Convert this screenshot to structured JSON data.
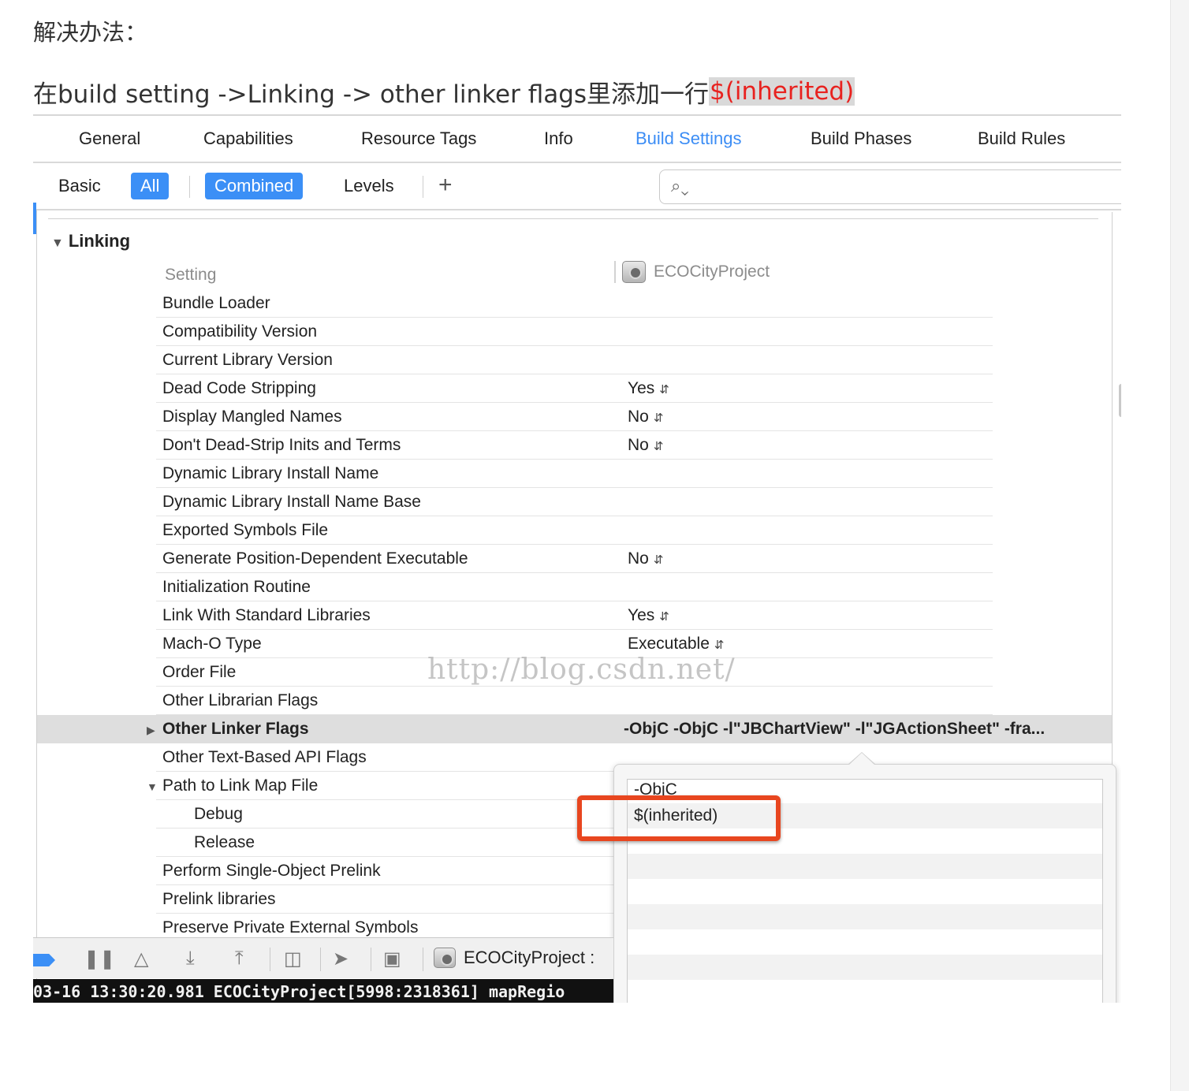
{
  "article": {
    "heading": "解决办法：",
    "instruction_prefix": "在build setting ->Linking -> other linker flags里添加一行",
    "instruction_highlight": "$(inherited)"
  },
  "tabs": [
    "General",
    "Capabilities",
    "Resource Tags",
    "Info",
    "Build Settings",
    "Build Phases",
    "Build Rules"
  ],
  "active_tab": "Build Settings",
  "filter": {
    "basic": "Basic",
    "all": "All",
    "combined": "Combined",
    "levels": "Levels",
    "add": "+",
    "search_placeholder": ""
  },
  "section": {
    "title": "Linking",
    "column_setting": "Setting",
    "column_target": "ECOCityProject"
  },
  "rows": [
    {
      "name": "Bundle Loader",
      "value": ""
    },
    {
      "name": "Compatibility Version",
      "value": ""
    },
    {
      "name": "Current Library Version",
      "value": ""
    },
    {
      "name": "Dead Code Stripping",
      "value": "Yes"
    },
    {
      "name": "Display Mangled Names",
      "value": "No"
    },
    {
      "name": "Don't Dead-Strip Inits and Terms",
      "value": "No"
    },
    {
      "name": "Dynamic Library Install Name",
      "value": ""
    },
    {
      "name": "Dynamic Library Install Name Base",
      "value": ""
    },
    {
      "name": "Exported Symbols File",
      "value": ""
    },
    {
      "name": "Generate Position-Dependent Executable",
      "value": "No"
    },
    {
      "name": "Initialization Routine",
      "value": ""
    },
    {
      "name": "Link With Standard Libraries",
      "value": "Yes"
    },
    {
      "name": "Mach-O Type",
      "value": "Executable"
    },
    {
      "name": "Order File",
      "value": ""
    },
    {
      "name": "Other Librarian Flags",
      "value": ""
    },
    {
      "name": "Other Linker Flags",
      "value": "-ObjC  -ObjC -l\"JBChartView\" -l\"JGActionSheet\" -fra..."
    },
    {
      "name": "Other Text-Based API Flags",
      "value": ""
    },
    {
      "name": "Path to Link Map File",
      "value": ""
    },
    {
      "name": "Debug",
      "value": ""
    },
    {
      "name": "Release",
      "value": ""
    },
    {
      "name": "Perform Single-Object Prelink",
      "value": ""
    },
    {
      "name": "Prelink libraries",
      "value": ""
    },
    {
      "name": "Preserve Private External Symbols",
      "value": ""
    }
  ],
  "watermark": "http://blog.csdn.net/",
  "popover_items": [
    "-ObjC",
    "$(inherited)"
  ],
  "debugbar": {
    "project_label": "ECOCityProject : "
  },
  "console_text": "03-16 13:30:20.981 ECOCityProject[5998:2318361] mapRegio"
}
